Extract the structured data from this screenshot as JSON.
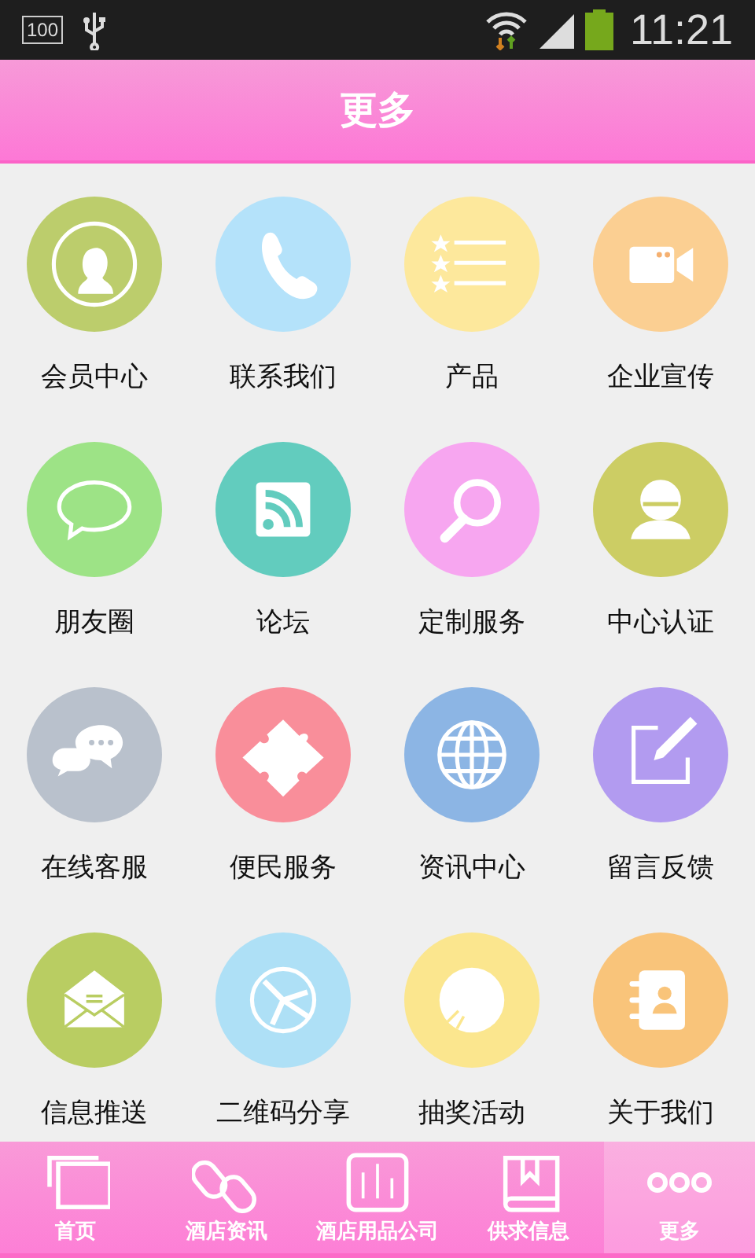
{
  "status_bar": {
    "battery_level_text": "100",
    "time": "11:21"
  },
  "header": {
    "title": "更多"
  },
  "grid": [
    {
      "label": "会员中心",
      "kind": "person",
      "color": "#bccd6c"
    },
    {
      "label": "联系我们",
      "kind": "phone",
      "color": "#b4e2fa"
    },
    {
      "label": "产品",
      "kind": "list",
      "color": "#fde89c"
    },
    {
      "label": "企业宣传",
      "kind": "video",
      "color": "#fbcf92"
    },
    {
      "label": "朋友圈",
      "kind": "chat",
      "color": "#9de386"
    },
    {
      "label": "论坛",
      "kind": "rss",
      "color": "#62ccbe"
    },
    {
      "label": "定制服务",
      "kind": "search",
      "color": "#f7a6f0"
    },
    {
      "label": "中心认证",
      "kind": "user",
      "color": "#cccd64"
    },
    {
      "label": "在线客服",
      "kind": "chats",
      "color": "#b9c1cc"
    },
    {
      "label": "便民服务",
      "kind": "puzzle",
      "color": "#f98e9a"
    },
    {
      "label": "资讯中心",
      "kind": "globe",
      "color": "#8cb5e4"
    },
    {
      "label": "留言反馈",
      "kind": "edit",
      "color": "#b29bf0"
    },
    {
      "label": "信息推送",
      "kind": "mail",
      "color": "#b9cd62"
    },
    {
      "label": "二维码分享",
      "kind": "share",
      "color": "#aee0f6"
    },
    {
      "label": "抽奖活动",
      "kind": "disc",
      "color": "#fbe68e"
    },
    {
      "label": "关于我们",
      "kind": "contacts",
      "color": "#f9c47a"
    }
  ],
  "tabs": [
    {
      "label": "首页",
      "kind": "pages",
      "selected": false
    },
    {
      "label": "酒店资讯",
      "kind": "link",
      "selected": false
    },
    {
      "label": "酒店用品公司",
      "kind": "chart",
      "selected": false
    },
    {
      "label": "供求信息",
      "kind": "book",
      "selected": false
    },
    {
      "label": "更多",
      "kind": "dots",
      "selected": true
    }
  ]
}
